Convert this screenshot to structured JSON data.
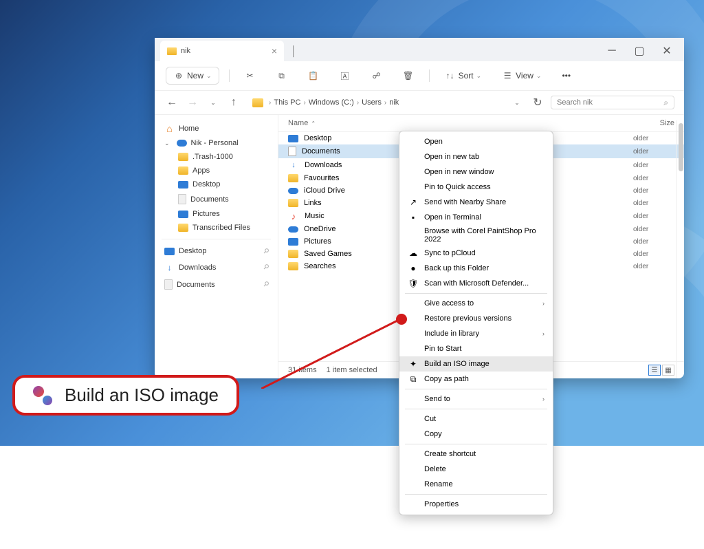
{
  "tab": {
    "title": "nik"
  },
  "toolbar": {
    "new": "New",
    "sort": "Sort",
    "view": "View"
  },
  "breadcrumb": [
    "This PC",
    "Windows (C:)",
    "Users",
    "nik"
  ],
  "search": {
    "placeholder": "Search nik"
  },
  "columns": {
    "name": "Name",
    "size": "Size"
  },
  "sidebar": {
    "home": "Home",
    "personal": "Nik - Personal",
    "items": [
      ".Trash-1000",
      "Apps",
      "Desktop",
      "Documents",
      "Pictures",
      "Transcribed Files"
    ],
    "pinned": [
      "Desktop",
      "Downloads",
      "Documents"
    ]
  },
  "files": [
    {
      "name": "Desktop",
      "type": "folder",
      "icon": "desk"
    },
    {
      "name": "Documents",
      "type": "folder",
      "icon": "doc",
      "selected": true
    },
    {
      "name": "Downloads",
      "type": "folder",
      "icon": "dl"
    },
    {
      "name": "Favourites",
      "type": "folder",
      "icon": "fold"
    },
    {
      "name": "iCloud Drive",
      "type": "folder",
      "icon": "cloud"
    },
    {
      "name": "Links",
      "type": "folder",
      "icon": "fold"
    },
    {
      "name": "Music",
      "type": "folder",
      "icon": "music"
    },
    {
      "name": "OneDrive",
      "type": "folder",
      "icon": "cloud"
    },
    {
      "name": "Pictures",
      "type": "folder",
      "icon": "pic"
    },
    {
      "name": "Saved Games",
      "type": "folder",
      "icon": "fold"
    },
    {
      "name": "Searches",
      "type": "folder",
      "icon": "fold"
    }
  ],
  "status": {
    "items": "31 items",
    "selected": "1 item selected"
  },
  "type_label": "older",
  "ctx": [
    {
      "label": "Open"
    },
    {
      "label": "Open in new tab"
    },
    {
      "label": "Open in new window"
    },
    {
      "label": "Pin to Quick access"
    },
    {
      "label": "Send with Nearby Share",
      "icon": "share"
    },
    {
      "label": "Open in Terminal",
      "icon": "term"
    },
    {
      "label": "Browse with Corel PaintShop Pro 2022"
    },
    {
      "label": "Sync to pCloud",
      "icon": "pcloud"
    },
    {
      "label": "Back up this Folder",
      "icon": "backup"
    },
    {
      "label": "Scan with Microsoft Defender...",
      "icon": "shield"
    },
    {
      "sep": true
    },
    {
      "label": "Give access to",
      "sub": true
    },
    {
      "label": "Restore previous versions"
    },
    {
      "label": "Include in library",
      "sub": true
    },
    {
      "label": "Pin to Start"
    },
    {
      "label": "Build an ISO image",
      "icon": "iso",
      "hl": true
    },
    {
      "label": "Copy as path",
      "icon": "copy"
    },
    {
      "sep": true
    },
    {
      "label": "Send to",
      "sub": true
    },
    {
      "sep": true
    },
    {
      "label": "Cut"
    },
    {
      "label": "Copy"
    },
    {
      "sep": true
    },
    {
      "label": "Create shortcut"
    },
    {
      "label": "Delete"
    },
    {
      "label": "Rename"
    },
    {
      "sep": true
    },
    {
      "label": "Properties"
    }
  ],
  "callout": "Build an ISO image"
}
